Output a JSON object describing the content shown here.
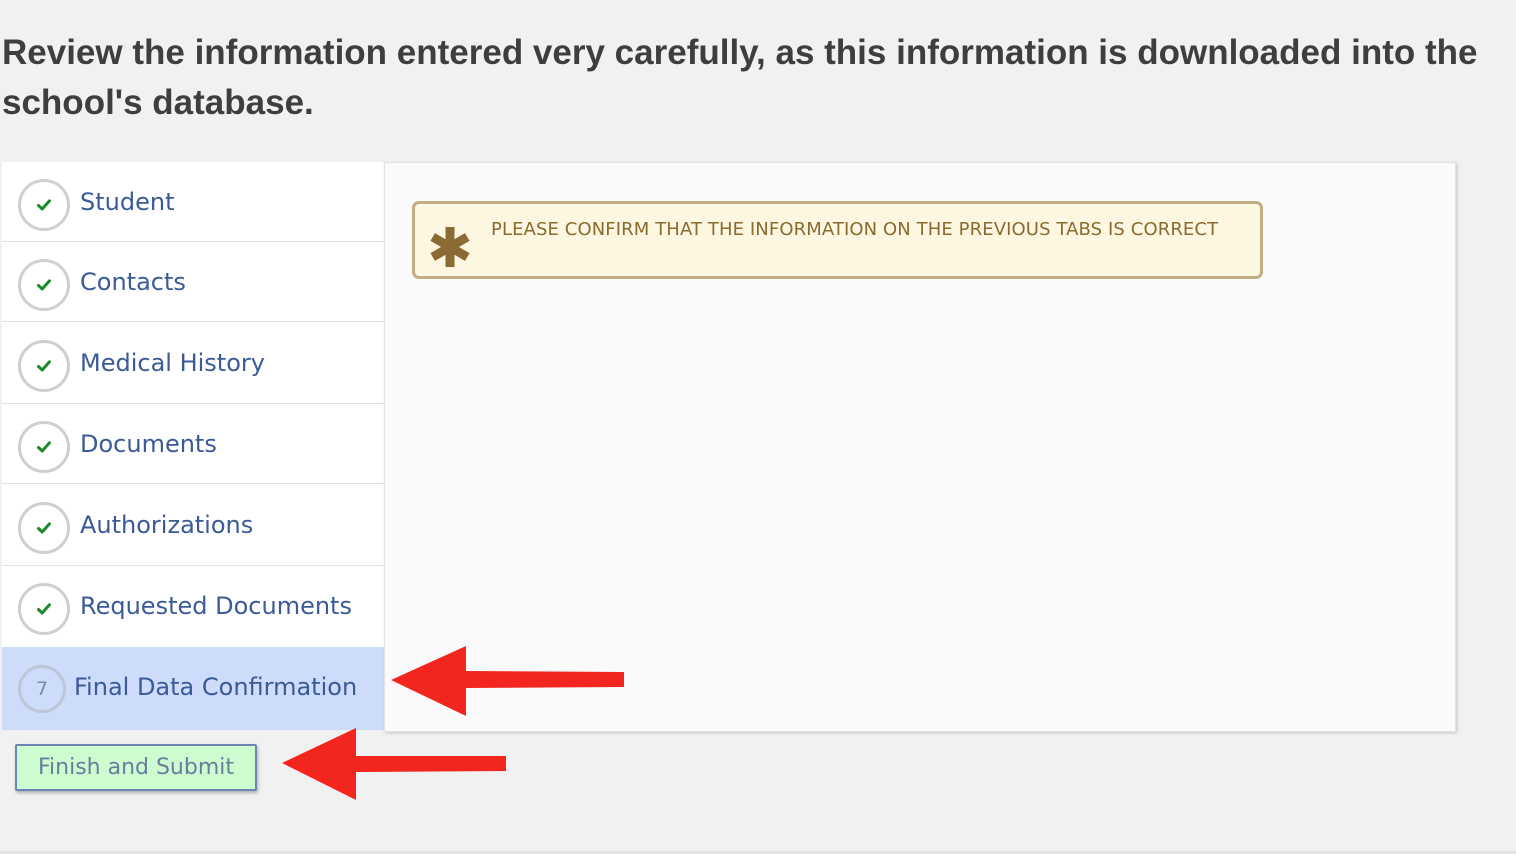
{
  "header": {
    "instructions": "Review the information entered very carefully, as this information is downloaded into the school's database."
  },
  "steps": [
    {
      "label": "Student",
      "status": "complete",
      "icon": "checkmark-icon"
    },
    {
      "label": "Contacts",
      "status": "complete",
      "icon": "checkmark-icon"
    },
    {
      "label": "Medical History",
      "status": "complete",
      "icon": "checkmark-icon"
    },
    {
      "label": "Documents",
      "status": "complete",
      "icon": "checkmark-icon"
    },
    {
      "label": "Authorizations",
      "status": "complete",
      "icon": "checkmark-icon"
    },
    {
      "label": "Requested Documents",
      "status": "complete",
      "icon": "checkmark-icon"
    },
    {
      "label": "Final Data Confirmation",
      "status": "active",
      "number": "7"
    }
  ],
  "notice": {
    "icon": "asterisk-icon",
    "text": "PLEASE CONFIRM THAT THE INFORMATION ON THE PREVIOUS TABS IS CORRECT"
  },
  "actions": {
    "finish_label": "Finish and Submit"
  },
  "annotations": {
    "arrow_color": "#f2261f"
  },
  "colors": {
    "step_label": "#3a5a98",
    "active_step_bg": "#cddcfb",
    "check": "#1d8a2a",
    "notice_bg": "#fdf7e2",
    "notice_border": "#c2ae83",
    "notice_text": "#8a6a2d",
    "button_bg": "#cdfcd0"
  }
}
